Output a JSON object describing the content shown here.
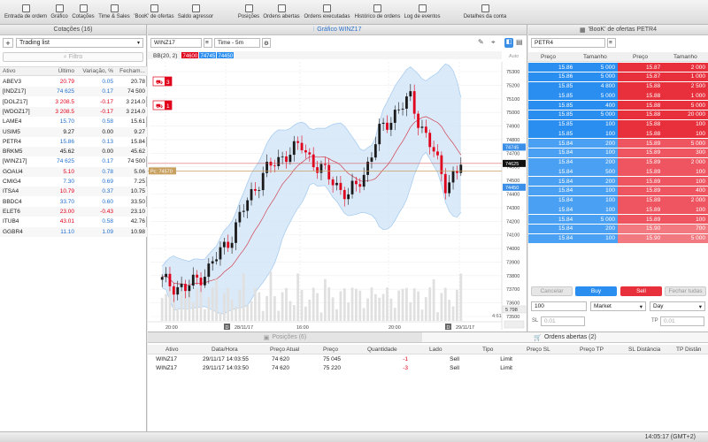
{
  "toolbar": {
    "items": [
      {
        "label": "Entrada de ordem",
        "icon": "order-entry-icon"
      },
      {
        "label": "Gráfico",
        "icon": "chart-icon"
      },
      {
        "label": "Cotações",
        "icon": "quotes-icon"
      },
      {
        "label": "Time & Sales",
        "icon": "time-sales-icon"
      },
      {
        "label": "'BooK' de ofertas",
        "icon": "book-icon"
      },
      {
        "label": "Saldo agressor",
        "icon": "balance-icon"
      },
      {
        "label": "Posições",
        "icon": "positions-icon"
      },
      {
        "label": "Ordens abertas",
        "icon": "open-orders-icon"
      },
      {
        "label": "Ordens executadas",
        "icon": "executed-orders-icon"
      },
      {
        "label": "Histórico de ordens",
        "icon": "order-history-icon"
      },
      {
        "label": "Log de eventos",
        "icon": "event-log-icon"
      },
      {
        "label": "Detalhes da conta",
        "icon": "account-details-icon"
      }
    ]
  },
  "watchlist": {
    "title": "Cotações (16)",
    "list_name": "Trading list",
    "filter_placeholder": "Filtro",
    "columns": [
      "Ativo",
      "Último",
      "Variação, %",
      "Fecham..."
    ],
    "rows": [
      {
        "symbol": "ABEV3",
        "last": "20.79",
        "change": "0.05",
        "close": "20.78",
        "color": "red"
      },
      {
        "symbol": "[INDZ17]",
        "last": "74 625",
        "change": "0.17",
        "close": "74 500",
        "color": "blue"
      },
      {
        "symbol": "[DOLZ17]",
        "last": "3 208.5",
        "change": "-0.17",
        "close": "3 214.0",
        "color": "red"
      },
      {
        "symbol": "[WDOZ17]",
        "last": "3 208.5",
        "change": "-0.17",
        "close": "3 214.0",
        "color": "red"
      },
      {
        "symbol": "LAME4",
        "last": "15.70",
        "change": "0.58",
        "close": "15.61",
        "color": "blue"
      },
      {
        "symbol": "USIM5",
        "last": "9.27",
        "change": "0.00",
        "close": "9.27",
        "color": "black"
      },
      {
        "symbol": "PETR4",
        "last": "15.86",
        "change": "0.13",
        "close": "15.84",
        "color": "blue"
      },
      {
        "symbol": "BRKM5",
        "last": "45.62",
        "change": "0.00",
        "close": "45.62",
        "color": "black"
      },
      {
        "symbol": "[WINZ17]",
        "last": "74 625",
        "change": "0.17",
        "close": "74 500",
        "color": "blue"
      },
      {
        "symbol": "GOAU4",
        "last": "5.10",
        "change": "0.78",
        "close": "5.06",
        "color": "red"
      },
      {
        "symbol": "CMIG4",
        "last": "7.30",
        "change": "0.69",
        "close": "7.25",
        "color": "blue"
      },
      {
        "symbol": "ITSA4",
        "last": "10.79",
        "change": "0.37",
        "close": "10.75",
        "color": "red"
      },
      {
        "symbol": "BBDC4",
        "last": "33.70",
        "change": "0.60",
        "close": "33.50",
        "color": "blue"
      },
      {
        "symbol": "ELET6",
        "last": "23.00",
        "change": "-0.43",
        "close": "23.10",
        "color": "red"
      },
      {
        "symbol": "ITUB4",
        "last": "43.01",
        "change": "0.58",
        "close": "42.76",
        "color": "red"
      },
      {
        "symbol": "GGBR4",
        "last": "11.10",
        "change": "1.09",
        "close": "10.98",
        "color": "blue"
      }
    ]
  },
  "chart": {
    "title": "Gráfico WINZ17",
    "symbol": "WINZ17",
    "timeframe": "Time - 5m",
    "indicator": "BB(20, 2)",
    "indicator_values": [
      "74600",
      "74745",
      "74450"
    ],
    "axis_hint": "Auto",
    "position_label": "Pc: 74570",
    "price_tag_upper": "74745",
    "price_tag_current": "74625",
    "price_tag_lower": "74450",
    "volume_label": "5 798",
    "time_label": "4:61",
    "order_marker_1": "3",
    "order_marker_2": "1",
    "x_labels": [
      "20:00",
      "28/11/17",
      "16:00",
      "20:00",
      "29/11/17"
    ],
    "day_marker": "D",
    "y_labels": [
      "75300",
      "75200",
      "75100",
      "75000",
      "74900",
      "74800",
      "74700",
      "74600",
      "74500",
      "74400",
      "74300",
      "74200",
      "74100",
      "74000",
      "73900",
      "73800",
      "73700",
      "73600",
      "73500"
    ],
    "colors": {
      "up": "#1a1a1a",
      "down": "#e0001b",
      "band": "#a9cdf0",
      "mid": "#d04050"
    }
  },
  "book": {
    "title": "'BooK' de ofertas PETR4",
    "symbol": "PETR4",
    "columns": [
      "Preço",
      "Tamanho",
      "Preço",
      "Tamanho"
    ],
    "rows": [
      {
        "bid": "15.86",
        "bid_size": "5 000",
        "ask": "15.87",
        "ask_size": "2 000"
      },
      {
        "bid": "15.86",
        "bid_size": "5 000",
        "ask": "15.87",
        "ask_size": "1 000"
      },
      {
        "bid": "15.85",
        "bid_size": "4 800",
        "ask": "15.88",
        "ask_size": "2 500"
      },
      {
        "bid": "15.85",
        "bid_size": "5 000",
        "ask": "15.88",
        "ask_size": "1 000"
      },
      {
        "bid": "15.85",
        "bid_size": "400",
        "ask": "15.88",
        "ask_size": "5 000"
      },
      {
        "bid": "15.85",
        "bid_size": "5 000",
        "ask": "15.88",
        "ask_size": "20 000"
      },
      {
        "bid": "15.85",
        "bid_size": "100",
        "ask": "15.88",
        "ask_size": "100"
      },
      {
        "bid": "15.85",
        "bid_size": "100",
        "ask": "15.88",
        "ask_size": "100"
      },
      {
        "bid": "15.84",
        "bid_size": "200",
        "ask": "15.89",
        "ask_size": "5 000"
      },
      {
        "bid": "15.84",
        "bid_size": "100",
        "ask": "15.89",
        "ask_size": "300"
      },
      {
        "bid": "15.84",
        "bid_size": "200",
        "ask": "15.89",
        "ask_size": "2 000"
      },
      {
        "bid": "15.84",
        "bid_size": "500",
        "ask": "15.89",
        "ask_size": "100"
      },
      {
        "bid": "15.84",
        "bid_size": "200",
        "ask": "15.89",
        "ask_size": "100"
      },
      {
        "bid": "15.84",
        "bid_size": "100",
        "ask": "15.89",
        "ask_size": "400"
      },
      {
        "bid": "15.84",
        "bid_size": "100",
        "ask": "15.89",
        "ask_size": "2 000"
      },
      {
        "bid": "15.84",
        "bid_size": "100",
        "ask": "15.89",
        "ask_size": "100"
      },
      {
        "bid": "15.84",
        "bid_size": "5 000",
        "ask": "15.89",
        "ask_size": "100"
      },
      {
        "bid": "15.84",
        "bid_size": "200",
        "ask": "15.90",
        "ask_size": "700"
      },
      {
        "bid": "15.84",
        "bid_size": "100",
        "ask": "15.90",
        "ask_size": "5 000"
      }
    ],
    "cancel_label": "Cancelar",
    "buy_label": "Buy",
    "sell_label": "Sell",
    "close_all_label": "Fechar tudas",
    "quantity": "100",
    "order_type": "Market",
    "validity": "Day",
    "sl_label": "SL",
    "sl_placeholder": "0.01",
    "tp_label": "TP",
    "tp_placeholder": "0.01"
  },
  "bottom": {
    "positions_tab": "Posições (6)",
    "open_orders_tab": "Ordens abertas (2)",
    "columns": [
      "Ativo",
      "Data/Hora",
      "Preço Atual",
      "Preço",
      "Quantidade",
      "Lado",
      "Tipo",
      "Preço SL",
      "Preço TP",
      "SL Distância",
      "TP Distân"
    ],
    "rows": [
      {
        "asset": "WINZ17",
        "datetime": "29/11/17 14:03:55",
        "current": "74 620",
        "price": "75 045",
        "qty": "-1",
        "side": "Sell",
        "type": "Limit"
      },
      {
        "asset": "WINZ17",
        "datetime": "29/11/17 14:03:50",
        "current": "74 620",
        "price": "75 220",
        "qty": "-3",
        "side": "Sell",
        "type": "Limit"
      }
    ]
  },
  "status": {
    "time": "14:05:17 (GMT+2)"
  }
}
